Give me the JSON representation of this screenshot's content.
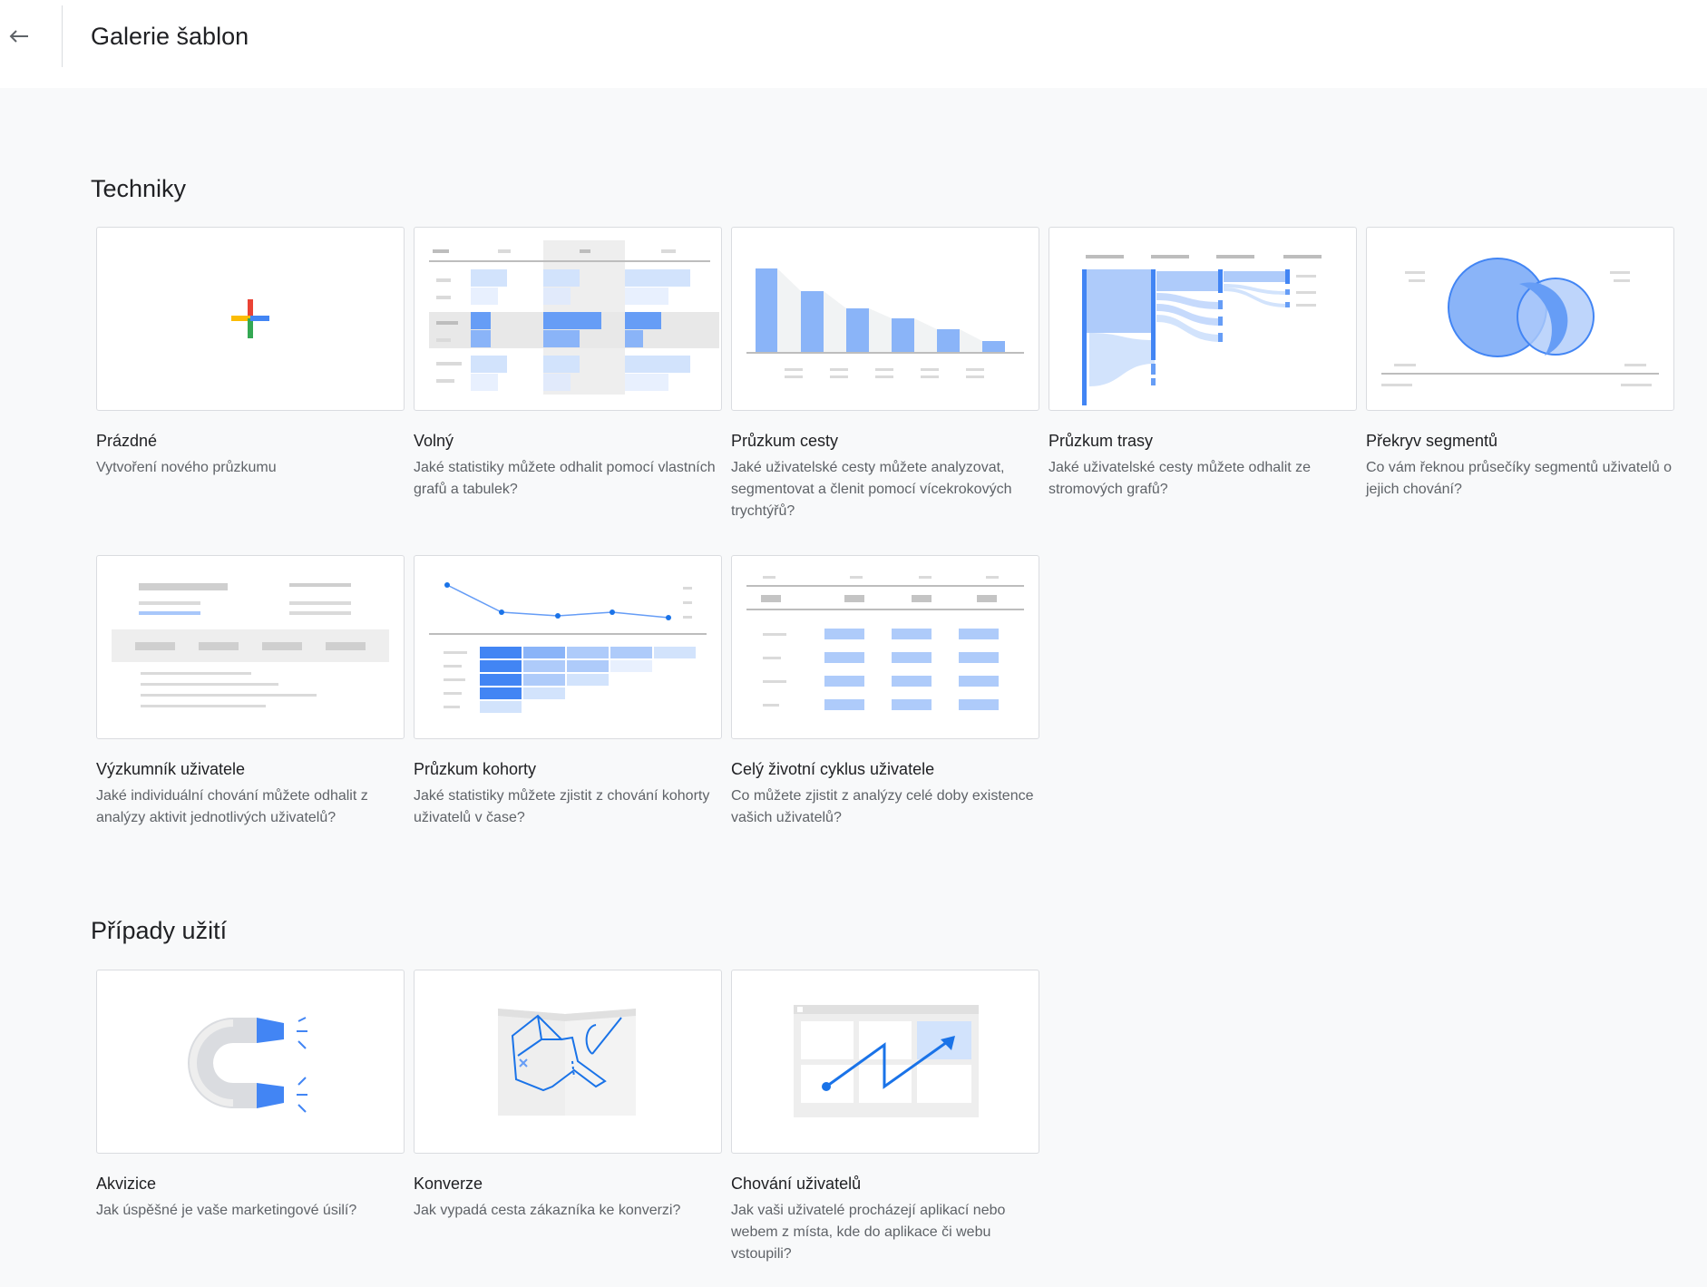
{
  "header": {
    "title": "Galerie šablon",
    "back_icon": "arrow-left-icon"
  },
  "sections": {
    "techniques": {
      "title": "Techniky",
      "cards": [
        {
          "title": "Prázdné",
          "desc": "Vytvoření nového průzkumu"
        },
        {
          "title": "Volný",
          "desc": "Jaké statistiky můžete odhalit pomocí vlastních grafů a tabulek?"
        },
        {
          "title": "Průzkum cesty",
          "desc": "Jaké uživatelské cesty můžete analyzovat, segmentovat a členit pomocí vícekrokových trychtýřů?"
        },
        {
          "title": "Průzkum trasy",
          "desc": "Jaké uživatelské cesty můžete odhalit ze stromových grafů?"
        },
        {
          "title": "Překryv segmentů",
          "desc": "Co vám řeknou průsečíky segmentů uživatelů o jejich chování?"
        },
        {
          "title": "Výzkumník uživatele",
          "desc": "Jaké individuální chování můžete odhalit z analýzy aktivit jednotlivých uživatelů?"
        },
        {
          "title": "Průzkum kohorty",
          "desc": "Jaké statistiky můžete zjistit z chování kohorty uživatelů v čase?"
        },
        {
          "title": "Celý životní cyklus uživatele",
          "desc": "Co můžete zjistit z analýzy celé doby existence vašich uživatelů?"
        }
      ]
    },
    "use_cases": {
      "title": "Případy užití",
      "cards": [
        {
          "title": "Akvizice",
          "desc": "Jak úspěšné je vaše marketingové úsilí?"
        },
        {
          "title": "Konverze",
          "desc": "Jak vypadá cesta zákazníka ke konverzi?"
        },
        {
          "title": "Chování uživatelů",
          "desc": "Jak vaši uživatelé procházejí aplikací nebo webem z místa, kde do aplikace či webu vstoupili?"
        }
      ]
    }
  },
  "colors": {
    "accent_blue": "#4285f4",
    "light_blue": "#aecbfa",
    "pale_blue": "#d2e3fc",
    "google_red": "#ea4335",
    "google_yellow": "#fbbc04",
    "google_green": "#34a853"
  }
}
